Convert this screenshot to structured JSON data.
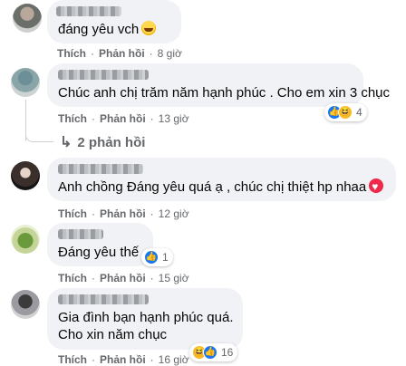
{
  "labels": {
    "like": "Thích",
    "reply": "Phản hồi"
  },
  "comments": [
    {
      "text": "đáng yêu vch",
      "time": "8 giờ"
    },
    {
      "text": "Chúc anh chị trăm năm hạnh phúc . Cho em xin 3 chục",
      "time": "13 giờ",
      "reaction_count": "4",
      "replies_label": "2 phản hồi"
    },
    {
      "text": "Anh chồng Đáng yêu quá ạ , chúc chị thiệt hp nhaa",
      "time": "12 giờ"
    },
    {
      "text": "Đáng yêu thế",
      "time": "15 giờ",
      "reaction_count": "1"
    },
    {
      "text_line1": "Gia đình bạn hạnh phúc quá.",
      "text_line2": "Cho xin năm chục",
      "time": "16 giờ",
      "reaction_count": "16"
    }
  ],
  "colors": {
    "bubble": "#f0f2f5",
    "meta_text": "#65676b",
    "like_blue": "#1877f2",
    "haha_yellow": "#f7b928"
  },
  "icons": {
    "reply_arrow": "reply-arrow-icon",
    "like": "like-reaction-icon",
    "haha": "haha-reaction-icon",
    "laugh": "laughing-emoji-icon",
    "heart": "heart-emoji-icon"
  }
}
